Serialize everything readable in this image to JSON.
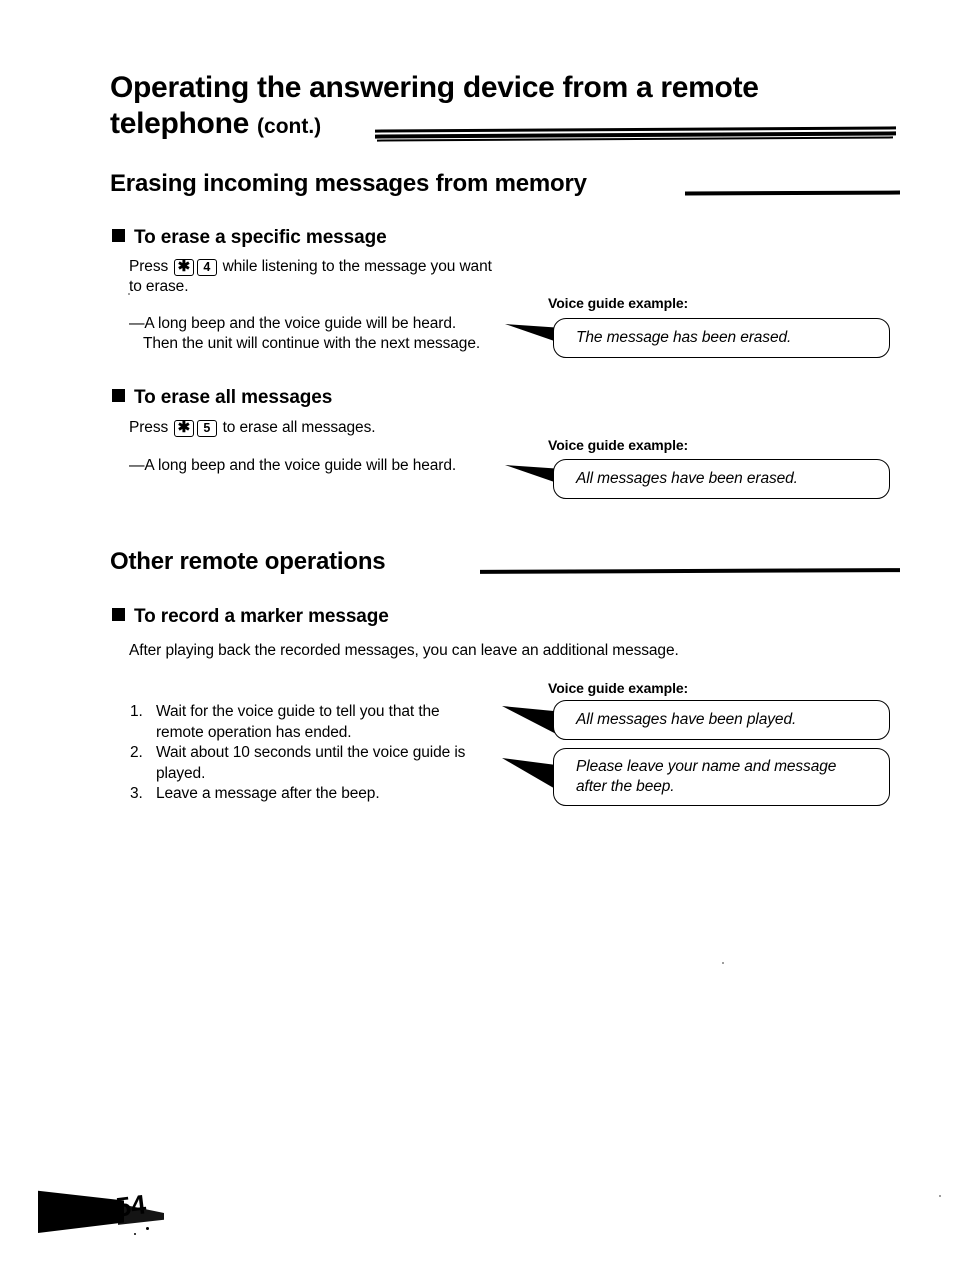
{
  "document": {
    "title_line1": "Operating the answering device from a remote",
    "title_line2": "telephone",
    "title_cont": "(cont.)",
    "page_number": "54"
  },
  "sections": [
    {
      "heading": "Erasing incoming messages from memory",
      "subsections": [
        {
          "heading": "To erase a specific message",
          "instruction_prefix": "Press",
          "key_star": "✱",
          "key_number": "4",
          "instruction_suffix": "while listening to the message you want",
          "instruction_line2": "to erase.",
          "result_line1": "—A long beep and the voice guide will be heard.",
          "result_line2": "Then the unit will continue with the next message.",
          "voice_guide_label": "Voice guide example:",
          "voice_guide_text": "The message has been erased."
        },
        {
          "heading": "To erase all messages",
          "instruction_prefix": "Press",
          "key_star": "✱",
          "key_number": "5",
          "instruction_suffix": "to erase all messages.",
          "result_line1": "—A long beep and the voice guide will be heard.",
          "voice_guide_label": "Voice guide example:",
          "voice_guide_text": "All messages have been erased."
        }
      ]
    },
    {
      "heading": "Other remote operations",
      "subsections": [
        {
          "heading": "To record a marker message",
          "intro": "After playing back the recorded messages, you can leave an additional message.",
          "voice_guide_label": "Voice guide example:",
          "steps": [
            {
              "num": "1.",
              "line1": "Wait for the voice guide to tell you that the",
              "line2": "remote operation has ended."
            },
            {
              "num": "2.",
              "line1": "Wait about 10 seconds until the voice guide is",
              "line2": "played."
            },
            {
              "num": "3.",
              "line1": "Leave a message after the beep.",
              "line2": ""
            }
          ],
          "voice_guides": [
            {
              "line1": "All messages have been played.",
              "line2": ""
            },
            {
              "line1": "Please leave your name and message",
              "line2": "after the beep."
            }
          ]
        }
      ]
    }
  ],
  "colors": {
    "ink": "#000000",
    "paper": "#ffffff"
  }
}
